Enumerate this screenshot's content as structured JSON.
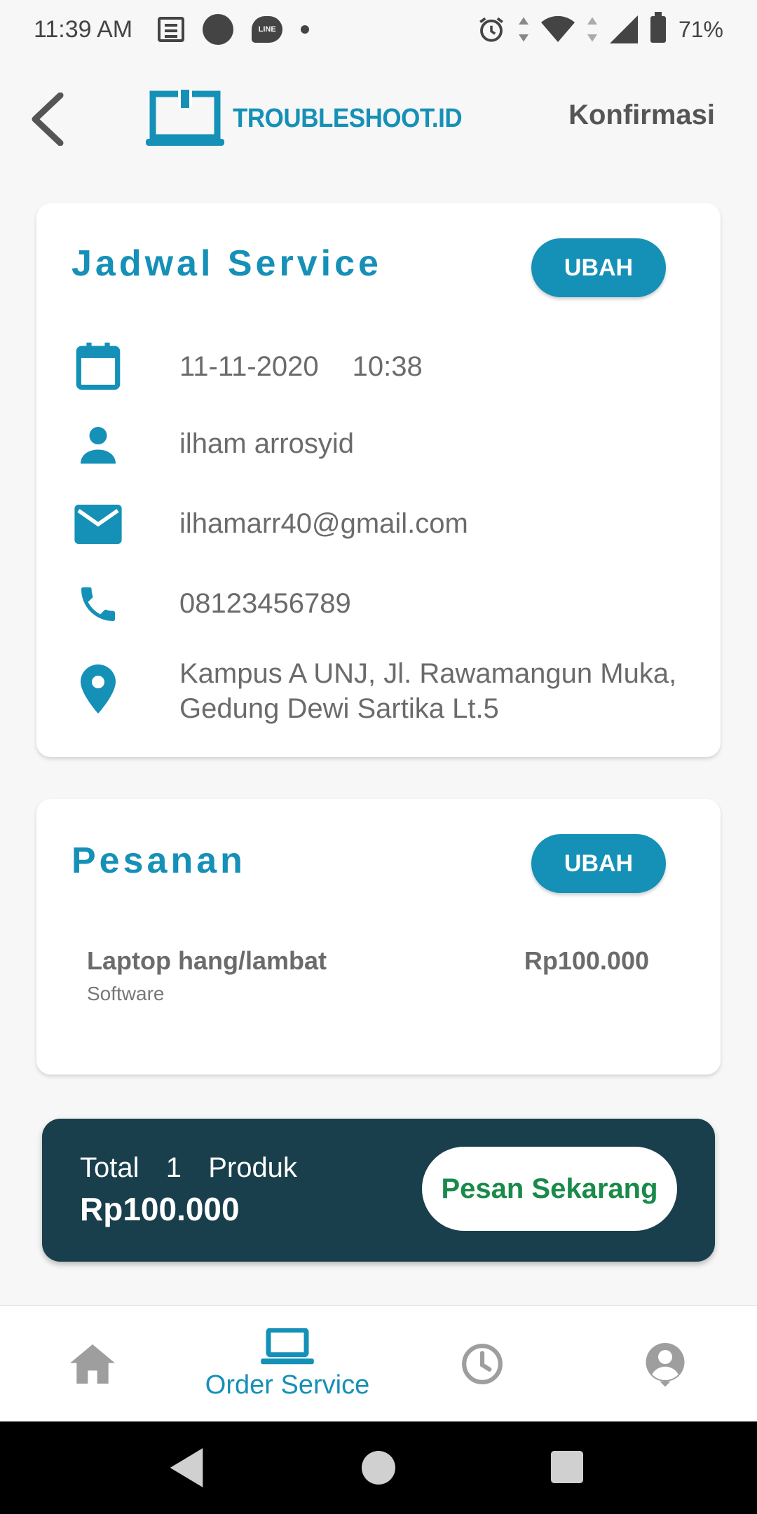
{
  "status_bar": {
    "time": "11:39 AM",
    "line_label": "LINE",
    "battery": "71%"
  },
  "header": {
    "brand": "TROUBLESHOOT.ID",
    "title": "Konfirmasi"
  },
  "schedule": {
    "title": "Jadwal Service",
    "edit_label": "UBAH",
    "date": "11-11-2020",
    "time": "10:38",
    "name": "ilham arrosyid",
    "email": "ilhamarr40@gmail.com",
    "phone": "08123456789",
    "address_line1": "Kampus A UNJ, Jl. Rawamangun Muka,",
    "address_line2": "Gedung Dewi Sartika Lt.5"
  },
  "order": {
    "title": "Pesanan",
    "edit_label": "UBAH",
    "items": [
      {
        "name": "Laptop hang/lambat",
        "category": "Software",
        "price": "Rp100.000"
      }
    ]
  },
  "total": {
    "label": "Total  1  Produk",
    "price": "Rp100.000",
    "order_button": "Pesan Sekarang"
  },
  "bottom_nav": {
    "items": [
      {
        "icon": "home-icon",
        "label": ""
      },
      {
        "icon": "laptop-icon",
        "label": "Order Service",
        "active": true
      },
      {
        "icon": "clock-icon",
        "label": ""
      },
      {
        "icon": "account-icon",
        "label": ""
      }
    ]
  },
  "colors": {
    "primary": "#1590b7",
    "dark_bar": "#193f4c",
    "order_button_text": "#1a8a4a",
    "inactive_icon": "#9e9e9e"
  }
}
